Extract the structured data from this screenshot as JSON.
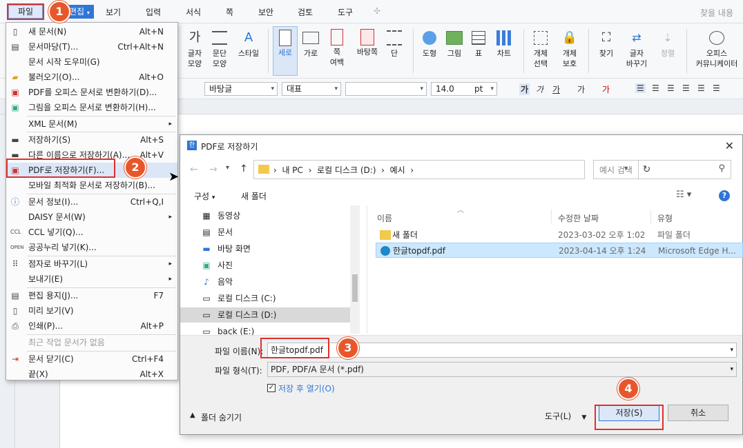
{
  "menubar": {
    "file": "파일",
    "edit": "편집",
    "items": [
      "보기",
      "입력",
      "서식",
      "쪽",
      "보안",
      "검토",
      "도구"
    ],
    "search": "찾을 내용"
  },
  "ribbon": {
    "char_shape": [
      "글자",
      "모양"
    ],
    "para_shape": [
      "문단",
      "모양"
    ],
    "style": "스타일",
    "vertical": "세로",
    "horizontal": "가로",
    "page_margin": [
      "쪽",
      "여백"
    ],
    "background": "바탕쪽",
    "column": "단",
    "shape": "도형",
    "picture": "그림",
    "table": "표",
    "chart": "차트",
    "obj_select": [
      "개체",
      "선택"
    ],
    "obj_protect": [
      "개체",
      "보호"
    ],
    "find": "찾기",
    "char_change": [
      "글자",
      "바꾸기"
    ],
    "arrange": "정렬",
    "office": [
      "오피스",
      "커뮤니케이터"
    ]
  },
  "fmtbar": {
    "style": "바탕글",
    "lang": "대표",
    "font": "",
    "size": "14.0",
    "unit": "pt"
  },
  "filemenu": {
    "items": [
      {
        "label": "새 문서(N)",
        "shortcut": "Alt+N",
        "icon": "new-doc-icon"
      },
      {
        "label": "문서마당(T)...",
        "shortcut": "Ctrl+Alt+N",
        "icon": "template-icon"
      },
      {
        "label": "문서 시작 도우미(G)",
        "shortcut": "",
        "icon": ""
      },
      {
        "label": "불러오기(O)...",
        "shortcut": "Alt+O",
        "icon": "open-folder-icon"
      },
      {
        "label": "PDF를 오피스 문서로 변환하기(D)...",
        "shortcut": "",
        "icon": "pdf-convert-icon"
      },
      {
        "label": "그림을 오피스 문서로 변환하기(H)...",
        "shortcut": "",
        "icon": "image-convert-icon"
      },
      {
        "label": "XML 문서(M)",
        "shortcut": "",
        "icon": ""
      },
      {
        "label": "저장하기(S)",
        "shortcut": "Alt+S",
        "icon": "save-icon"
      },
      {
        "label": "다른 이름으로 저장하기(A)...",
        "shortcut": "Alt+V",
        "icon": "save-as-icon"
      },
      {
        "label": "PDF로 저장하기(F)...",
        "shortcut": "",
        "icon": "pdf-save-icon"
      },
      {
        "label": "모바일 최적화 문서로 저장하기(B)...",
        "shortcut": "",
        "icon": ""
      },
      {
        "label": "문서 정보(I)...",
        "shortcut": "Ctrl+Q,I",
        "icon": "info-icon"
      },
      {
        "label": "DAISY 문서(W)",
        "shortcut": "",
        "icon": ""
      },
      {
        "label": "CCL 넣기(Q)...",
        "shortcut": "",
        "icon": "ccl-icon"
      },
      {
        "label": "공공누리 넣기(K)...",
        "shortcut": "",
        "icon": "open-icon"
      },
      {
        "label": "점자로 바꾸기(L)",
        "shortcut": "",
        "icon": "braille-icon"
      },
      {
        "label": "보내기(E)",
        "shortcut": "",
        "icon": ""
      },
      {
        "label": "편집 용지(J)...",
        "shortcut": "F7",
        "icon": "page-setup-icon"
      },
      {
        "label": "미리 보기(V)",
        "shortcut": "",
        "icon": "preview-icon"
      },
      {
        "label": "인쇄(P)...",
        "shortcut": "Alt+P",
        "icon": "print-icon"
      },
      {
        "label": "최근 작업 문서가 없음",
        "shortcut": "",
        "icon": ""
      },
      {
        "label": "문서 닫기(C)",
        "shortcut": "Ctrl+F4",
        "icon": "close-doc-icon"
      },
      {
        "label": "끝(X)",
        "shortcut": "Alt+X",
        "icon": ""
      }
    ]
  },
  "dialog": {
    "title": "PDF로 저장하기",
    "breadcrumb": [
      "내 PC",
      "로컬 디스크 (D:)",
      "예시"
    ],
    "search_placeholder": "예시 검색",
    "organize": "구성",
    "new_folder": "새 폴더",
    "nav": [
      "동영상",
      "문서",
      "바탕 화면",
      "사진",
      "음악",
      "로컬 디스크 (C:)",
      "로컬 디스크 (D:)",
      "back (E:)"
    ],
    "columns": {
      "name": "이름",
      "date": "수정한 날짜",
      "type": "유형"
    },
    "files": [
      {
        "name": "새 폴더",
        "date": "2023-03-02 오후 1:02",
        "type": "파일 폴더"
      },
      {
        "name": "한글topdf.pdf",
        "date": "2023-04-14 오후 1:24",
        "type": "Microsoft Edge H..."
      }
    ],
    "filename_label": "파일 이름(N):",
    "filename_value": "한글topdf.pdf",
    "filetype_label": "파일 형식(T):",
    "filetype_value": "PDF, PDF/A 문서 (*.pdf)",
    "open_after": "저장 후 열기(O)",
    "hide_folders": "폴더 숨기기",
    "tools": "도구(L)",
    "save": "저장(S)",
    "cancel": "취소"
  },
  "badges": [
    "1",
    "2",
    "3",
    "4"
  ],
  "colors": {
    "accent": "#2f75d6",
    "badge": "#e8572b",
    "highlight": "#e0302c"
  }
}
